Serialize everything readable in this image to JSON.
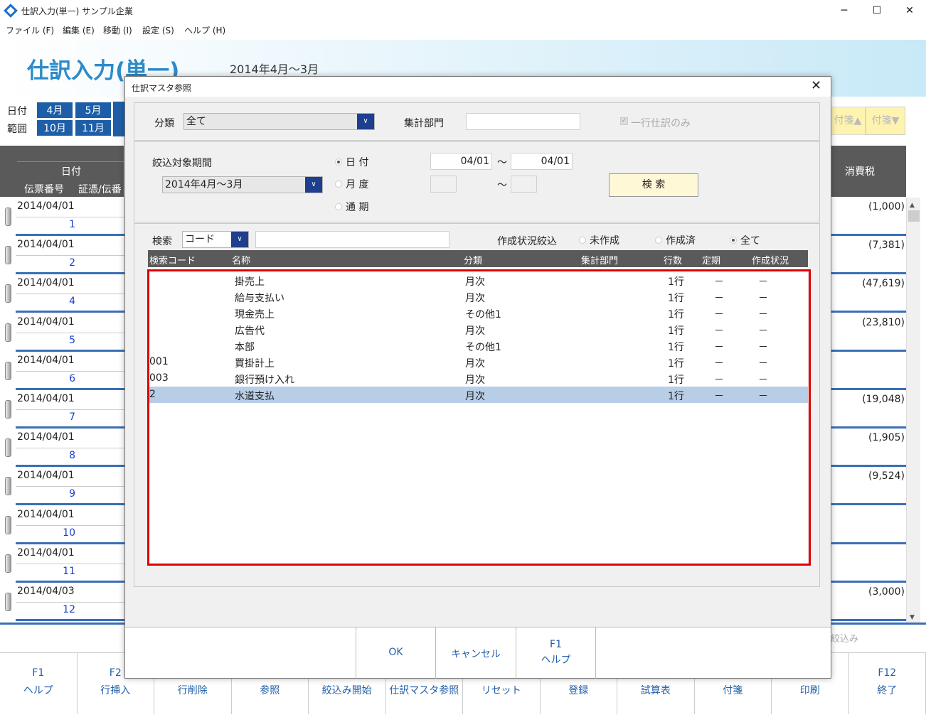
{
  "window": {
    "title": "仕訳入力(単一) サンプル企業",
    "minimize": "─",
    "maximize": "☐",
    "close": "✕"
  },
  "menu": [
    "ファイル (F)",
    "編集 (E)",
    "移動 (I)",
    "設定 (S)",
    "ヘルプ (H)"
  ],
  "header": {
    "title": "仕訳入力(単一)",
    "period": "2014年4月～3月"
  },
  "background": {
    "date_label": "日付",
    "range_label": "範囲",
    "months_row1": [
      "4月",
      "5月"
    ],
    "months_row2": [
      "10月",
      "11月"
    ],
    "col_date": "日付",
    "col_slip": "伝票番号",
    "col_voucher": "証憑/伝番",
    "col_tax": "消費税",
    "tag_up": "付箋▲",
    "tag_down": "付箋▼",
    "filtered": "絞込み",
    "rows": [
      {
        "date": "2014/04/01",
        "num": "1",
        "tax": "(1,000)"
      },
      {
        "date": "2014/04/01",
        "num": "2",
        "tax": "(7,381)"
      },
      {
        "date": "2014/04/01",
        "num": "4",
        "tax": "(47,619)"
      },
      {
        "date": "2014/04/01",
        "num": "5",
        "tax": "(23,810)"
      },
      {
        "date": "2014/04/01",
        "num": "6",
        "tax": ""
      },
      {
        "date": "2014/04/01",
        "num": "7",
        "tax": "(19,048)"
      },
      {
        "date": "2014/04/01",
        "num": "8",
        "tax": "(1,905)"
      },
      {
        "date": "2014/04/01",
        "num": "9",
        "tax": "(9,524)"
      },
      {
        "date": "2014/04/01",
        "num": "10",
        "tax": ""
      },
      {
        "date": "2014/04/01",
        "num": "11",
        "tax": ""
      },
      {
        "date": "2014/04/03",
        "num": "12",
        "tax": "(3,000)"
      }
    ],
    "fkeys": [
      {
        "k": "F1",
        "l": "ヘルプ"
      },
      {
        "k": "F2",
        "l": "行挿入"
      },
      {
        "k": "",
        "l": "行削除"
      },
      {
        "k": "",
        "l": "参照"
      },
      {
        "k": "",
        "l": "絞込み開始"
      },
      {
        "k": "",
        "l": "仕訳マスタ参照"
      },
      {
        "k": "",
        "l": "リセット"
      },
      {
        "k": "",
        "l": "登録"
      },
      {
        "k": "",
        "l": "試算表"
      },
      {
        "k": "",
        "l": "付箋"
      },
      {
        "k": "",
        "l": "印刷"
      },
      {
        "k": "F12",
        "l": "終了"
      }
    ]
  },
  "modal": {
    "title": "仕訳マスタ参照",
    "close": "✕",
    "category_label": "分類",
    "category_value": "全て",
    "dept_label": "集計部門",
    "dept_value": "",
    "single_only": "一行仕訳のみ",
    "period_label": "絞込対象期間",
    "period_value": "2014年4月～3月",
    "radio_date": "日 付",
    "radio_month": "月 度",
    "radio_year": "通 期",
    "date_from": "04/01",
    "date_to": "04/01",
    "tilde": "～",
    "search_button": "検 索",
    "search_label": "検索",
    "search_type": "コード",
    "search_value": "",
    "status_label": "作成状況絞込",
    "status_none": "未作成",
    "status_done": "作成済",
    "status_all": "全て",
    "columns": [
      "検索コード",
      "名称",
      "分類",
      "集計部門",
      "行数",
      "定期",
      "作成状況"
    ],
    "rows": [
      {
        "code": "",
        "name": "掛売上",
        "cat": "月次",
        "dept": "",
        "lines": "1行",
        "periodic": "－",
        "status": "－"
      },
      {
        "code": "",
        "name": "給与支払い",
        "cat": "月次",
        "dept": "",
        "lines": "1行",
        "periodic": "－",
        "status": "－"
      },
      {
        "code": "",
        "name": "現金売上",
        "cat": "その他1",
        "dept": "",
        "lines": "1行",
        "periodic": "－",
        "status": "－"
      },
      {
        "code": "",
        "name": "広告代",
        "cat": "月次",
        "dept": "",
        "lines": "1行",
        "periodic": "－",
        "status": "－"
      },
      {
        "code": "",
        "name": "本部",
        "cat": "その他1",
        "dept": "",
        "lines": "1行",
        "periodic": "－",
        "status": "－"
      },
      {
        "code": "001",
        "name": "買掛計上",
        "cat": "月次",
        "dept": "",
        "lines": "1行",
        "periodic": "－",
        "status": "－"
      },
      {
        "code": "003",
        "name": "銀行預け入れ",
        "cat": "月次",
        "dept": "",
        "lines": "1行",
        "periodic": "－",
        "status": "－"
      },
      {
        "code": "2",
        "name": "水道支払",
        "cat": "月次",
        "dept": "",
        "lines": "1行",
        "periodic": "－",
        "status": "－"
      }
    ],
    "ok": "OK",
    "cancel": "キャンセル",
    "help_key": "F1",
    "help": "ヘルプ"
  }
}
